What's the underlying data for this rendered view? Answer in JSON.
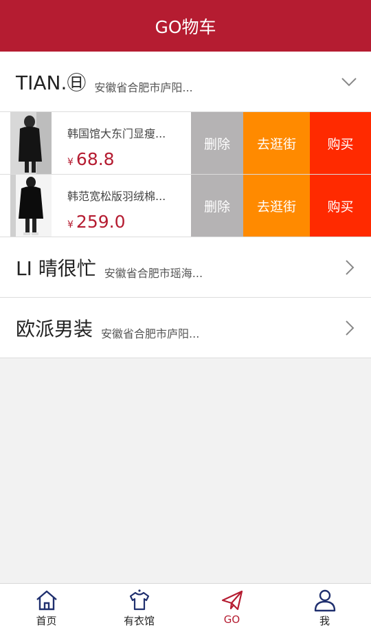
{
  "header": {
    "title": "GO物车"
  },
  "stores": [
    {
      "name": "TIAN.㊐",
      "address": "安徽省合肥市庐阳..."
    },
    {
      "name": "LI 晴很忙",
      "address": "安徽省合肥市瑶海..."
    },
    {
      "name": "欧派男装",
      "address": "安徽省合肥市庐阳..."
    }
  ],
  "items": [
    {
      "title": "韩国馆大东门显瘦...",
      "currency": "¥",
      "price": "68.8"
    },
    {
      "title": "韩范宽松版羽绒棉...",
      "currency": "¥",
      "price": "259.0"
    }
  ],
  "actions": {
    "delete": "删除",
    "shop": "去逛街",
    "buy": "购买"
  },
  "tabbar": [
    {
      "label": "首页",
      "icon": "home-icon"
    },
    {
      "label": "有衣馆",
      "icon": "tshirt-icon"
    },
    {
      "label": "GO",
      "icon": "paper-plane-icon"
    },
    {
      "label": "我",
      "icon": "user-icon"
    }
  ],
  "colors": {
    "brand": "#b51c31",
    "delete": "#b5b3b4",
    "shop": "#ff8a00",
    "buy": "#ff2a00"
  }
}
